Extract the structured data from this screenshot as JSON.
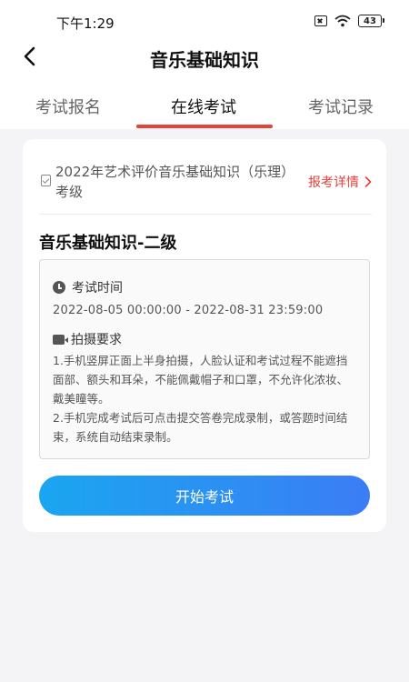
{
  "status_bar": {
    "time": "下午1:29",
    "battery": "43"
  },
  "navbar": {
    "title": "音乐基础知识"
  },
  "tabs": [
    {
      "label": "考试报名",
      "active": false
    },
    {
      "label": "在线考试",
      "active": true
    },
    {
      "label": "考试记录",
      "active": false
    }
  ],
  "exam": {
    "name": "2022年艺术评价音乐基础知识（乐理）考级",
    "detail_link": "报考详情",
    "level_title": "音乐基础知识-二级",
    "time_section_title": "考试时间",
    "time_range": "2022-08-05 00:00:00 - 2022-08-31 23:59:00",
    "photo_section_title": "拍摄要求",
    "requirements": [
      "1.手机竖屏正面上半身拍摄，人脸认证和考试过程不能遮挡面部、额头和耳朵，不能佩戴帽子和口罩，不允许化浓妆、戴美瞳等。",
      "2.手机完成考试后可点击提交答卷完成录制，或答题时间结束，系统自动结束录制。"
    ],
    "start_button": "开始考试"
  },
  "colors": {
    "accent": "#e8403a",
    "button_gradient_start": "#1aa6f0",
    "button_gradient_end": "#3b7df5",
    "background": "#f4f4f6"
  }
}
